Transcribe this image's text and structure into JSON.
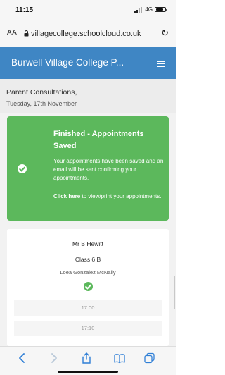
{
  "status_bar": {
    "time": "11:15",
    "network": "4G"
  },
  "browser": {
    "text_size_label": "AA",
    "url": "villagecollege.schoolcloud.co.uk"
  },
  "header": {
    "title": "Burwell Village College P..."
  },
  "subheader": {
    "title": "Parent Consultations,",
    "date": "Tuesday, 17th November"
  },
  "success": {
    "title": "Finished - Appointments Saved",
    "message": "Your appointments have been saved and an email will be sent confirming your appointments.",
    "link_text": "Click here",
    "link_suffix": " to view/print your appointments."
  },
  "appointment": {
    "teacher": "Mr B Hewitt",
    "class": "Class 6 B",
    "student": "Loea Gonzalez McNally",
    "slots": [
      "17:00",
      "17:10"
    ]
  },
  "colors": {
    "header": "#3f86c4",
    "success": "#5cb85c",
    "toolbar_icons": "#2f7fd6"
  },
  "icons": {
    "back": "chevron-left-icon",
    "forward": "chevron-right-icon",
    "share": "share-icon",
    "bookmarks": "book-icon",
    "tabs": "tabs-icon"
  }
}
